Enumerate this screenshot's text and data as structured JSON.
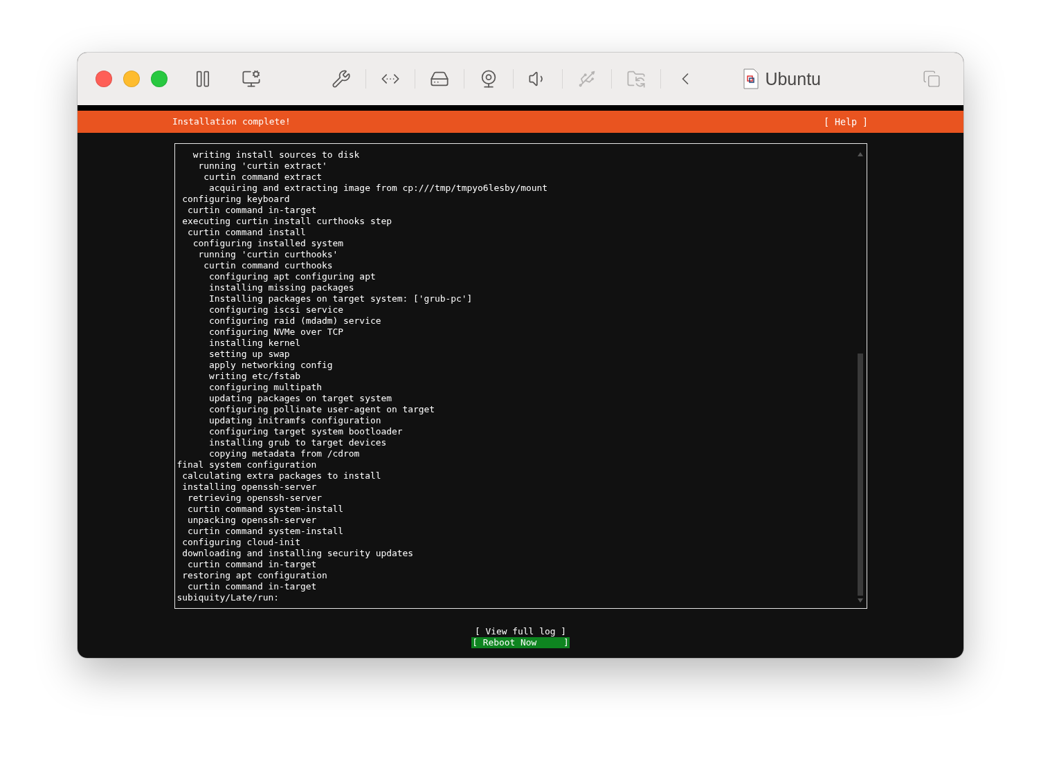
{
  "window": {
    "title": "Ubuntu"
  },
  "toolbar": [
    {
      "kind": "pause",
      "disabled": false
    },
    {
      "kind": "screenshot",
      "disabled": false
    },
    {
      "kind": "settings",
      "disabled": false
    },
    {
      "kind": "code",
      "disabled": false
    },
    {
      "kind": "disk",
      "disabled": false
    },
    {
      "kind": "camera",
      "disabled": false
    },
    {
      "kind": "sound",
      "disabled": false
    },
    {
      "kind": "usb",
      "disabled": true
    },
    {
      "kind": "folder",
      "disabled": true
    },
    {
      "kind": "back",
      "disabled": false
    }
  ],
  "header": {
    "title": "Installation complete!",
    "help": "[ Help ]"
  },
  "log": [
    "   writing install sources to disk",
    "    running 'curtin extract'",
    "     curtin command extract",
    "      acquiring and extracting image from cp:///tmp/tmpyo6lesby/mount",
    " configuring keyboard",
    "  curtin command in-target",
    " executing curtin install curthooks step",
    "  curtin command install",
    "   configuring installed system",
    "    running 'curtin curthooks'",
    "     curtin command curthooks",
    "      configuring apt configuring apt",
    "      installing missing packages",
    "      Installing packages on target system: ['grub-pc']",
    "      configuring iscsi service",
    "      configuring raid (mdadm) service",
    "      configuring NVMe over TCP",
    "      installing kernel",
    "      setting up swap",
    "      apply networking config",
    "      writing etc/fstab",
    "      configuring multipath",
    "      updating packages on target system",
    "      configuring pollinate user-agent on target",
    "      updating initramfs configuration",
    "      configuring target system bootloader",
    "      installing grub to target devices",
    "      copying metadata from /cdrom",
    "final system configuration",
    " calculating extra packages to install",
    " installing openssh-server",
    "  retrieving openssh-server",
    "  curtin command system-install",
    "  unpacking openssh-server",
    "  curtin command system-install",
    " configuring cloud-init",
    " downloading and installing security updates",
    "  curtin command in-target",
    " restoring apt configuration",
    "  curtin command in-target",
    "subiquity/Late/run:"
  ],
  "buttons": [
    {
      "label": "[ View full log ]",
      "selected": false
    },
    {
      "label": "[ Reboot Now     ]",
      "selected": true
    }
  ]
}
